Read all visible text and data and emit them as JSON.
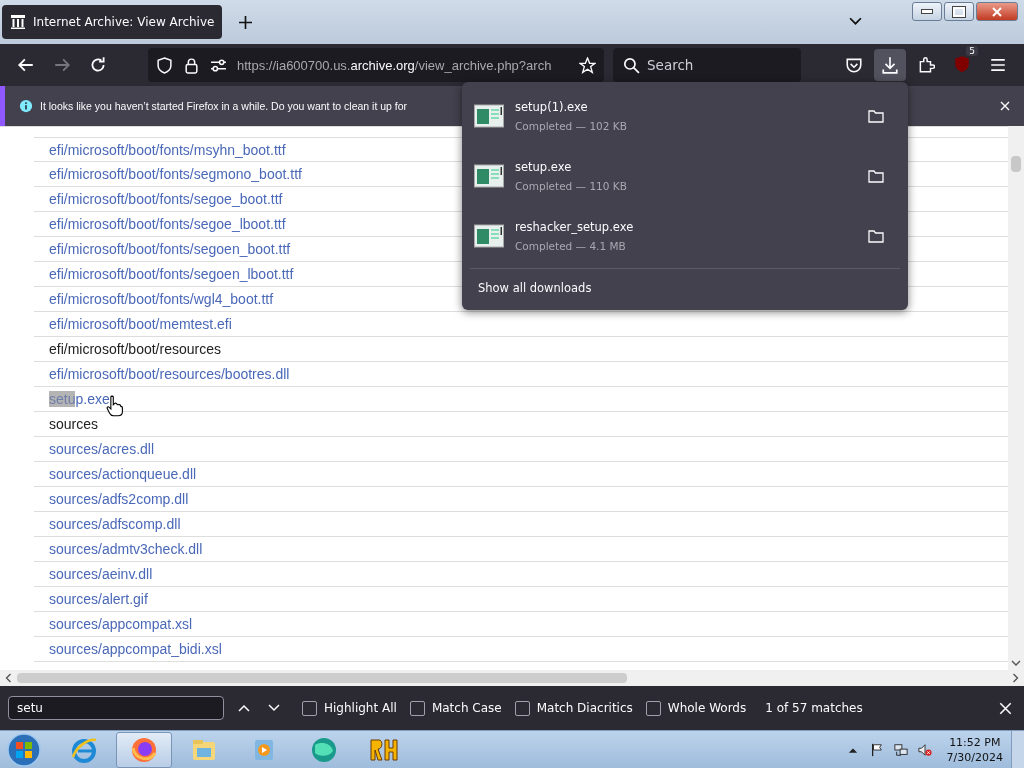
{
  "tab": {
    "title": "Internet Archive: View Archive",
    "selected": true
  },
  "toolbar": {
    "url_prefix": "https://ia600700.us.",
    "url_domain": "archive.org",
    "url_rest": "/view_archive.php?arch",
    "search_placeholder": "Search",
    "extensions_badge": "5"
  },
  "notification": {
    "text": "It looks like you haven’t started Firefox in a while. Do you want to clean it up for"
  },
  "rows": [
    {
      "kind": "file",
      "text": "efi/microsoft/boot/fonts/msyhn_boot.ttf"
    },
    {
      "kind": "file",
      "text": "efi/microsoft/boot/fonts/segmono_boot.ttf"
    },
    {
      "kind": "file",
      "text": "efi/microsoft/boot/fonts/segoe_boot.ttf"
    },
    {
      "kind": "file",
      "text": "efi/microsoft/boot/fonts/segoe_lboot.ttf"
    },
    {
      "kind": "file",
      "text": "efi/microsoft/boot/fonts/segoen_boot.ttf"
    },
    {
      "kind": "file",
      "text": "efi/microsoft/boot/fonts/segoen_lboot.ttf"
    },
    {
      "kind": "file",
      "text": "efi/microsoft/boot/fonts/wgl4_boot.ttf"
    },
    {
      "kind": "file",
      "text": "efi/microsoft/boot/memtest.efi"
    },
    {
      "kind": "folder",
      "text": "efi/microsoft/boot/resources"
    },
    {
      "kind": "file",
      "text": "efi/microsoft/boot/resources/bootres.dll"
    },
    {
      "kind": "file",
      "match": "setu",
      "text": "p.exe",
      "hovered": true
    },
    {
      "kind": "folder",
      "text": "sources"
    },
    {
      "kind": "file",
      "text": "sources/acres.dll"
    },
    {
      "kind": "file",
      "text": "sources/actionqueue.dll"
    },
    {
      "kind": "file",
      "text": "sources/adfs2comp.dll"
    },
    {
      "kind": "file",
      "text": "sources/adfscomp.dll"
    },
    {
      "kind": "file",
      "text": "sources/admtv3check.dll"
    },
    {
      "kind": "file",
      "text": "sources/aeinv.dll"
    },
    {
      "kind": "file",
      "text": "sources/alert.gif"
    },
    {
      "kind": "file",
      "text": "sources/appcompat.xsl"
    },
    {
      "kind": "file",
      "text": "sources/appcompat_bidi.xsl"
    }
  ],
  "downloads": {
    "items": [
      {
        "name": "setup(1).exe",
        "status": "Completed — 102 KB"
      },
      {
        "name": "setup.exe",
        "status": "Completed — 110 KB"
      },
      {
        "name": "reshacker_setup.exe",
        "status": "Completed — 4.1 MB"
      }
    ],
    "show_all": "Show all downloads"
  },
  "find_bar": {
    "value": "setu",
    "options": [
      {
        "label": "Highlight All",
        "checked": false
      },
      {
        "label": "Match Case",
        "checked": false
      },
      {
        "label": "Match Diacritics",
        "checked": false
      },
      {
        "label": "Whole Words",
        "checked": false
      }
    ],
    "result": "1 of 57 matches"
  },
  "taskbar": {
    "apps": [
      {
        "kind": "ie",
        "selected": false
      },
      {
        "kind": "firefox",
        "selected": true
      },
      {
        "kind": "explorer",
        "selected": false
      },
      {
        "kind": "media",
        "selected": false
      },
      {
        "kind": "globe",
        "selected": false
      },
      {
        "kind": "rh",
        "selected": false
      }
    ],
    "time": "11:52 PM",
    "date": "7/30/2024"
  }
}
